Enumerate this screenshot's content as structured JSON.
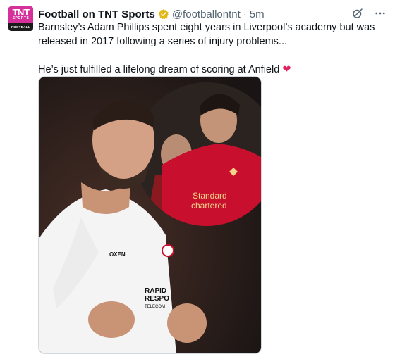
{
  "account": {
    "display_name": "Football on TNT Sports",
    "handle": "@footballontnt",
    "separator": "·",
    "time": "5m",
    "avatar_lines": [
      "TNT",
      "SPORTS",
      "FOOTBALL"
    ]
  },
  "tweet": {
    "line1": "Barnsley’s Adam Phillips spent eight years in Liverpool’s academy but was released in 2017 following a series of injury problems...",
    "line2": "He’s just fulfilled a lifelong dream of scoring at Anfield",
    "emoji": "❤"
  },
  "media": {
    "shirt_sponsor_main": "OXEN",
    "shirt_sponsor_chest": "RAPID",
    "shirt_sponsor_chest2": "RESPO",
    "shirt_sponsor_chest3": "TELECOM",
    "inset_sponsor_1": "Standard",
    "inset_sponsor_2": "chartered"
  },
  "colors": {
    "verified_gold": "#e2b719",
    "brand_pink": "#d6309a",
    "liverpool_red": "#c8102e"
  },
  "icons": [
    "verified-badge-icon",
    "grok-icon",
    "more-icon",
    "heart-emoji-icon"
  ]
}
